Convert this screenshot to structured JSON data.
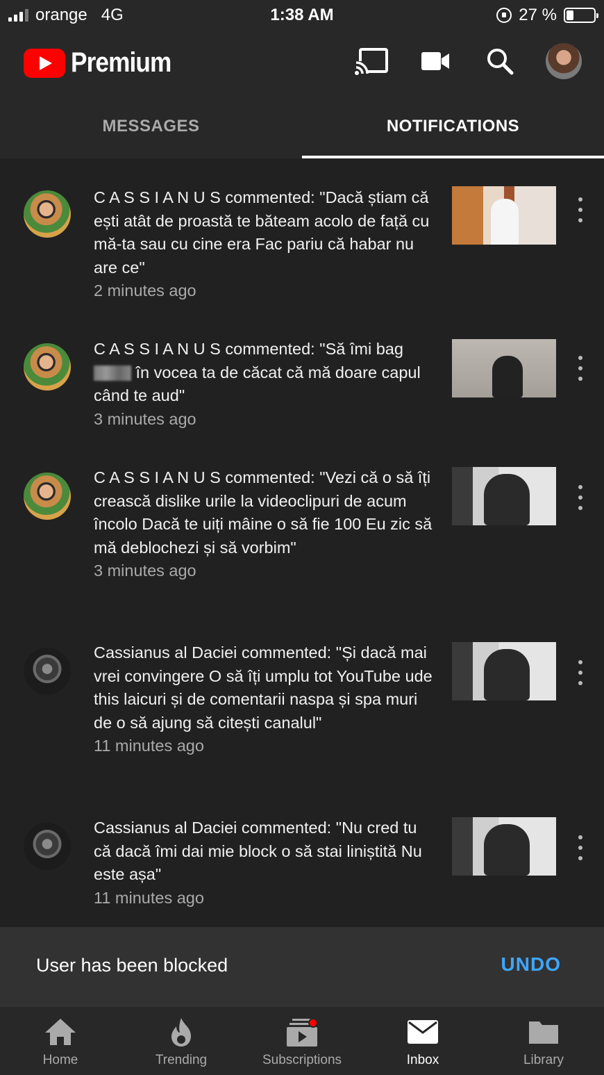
{
  "status_bar": {
    "carrier": "orange",
    "network": "4G",
    "time": "1:38 AM",
    "battery_percent_label": "27 %",
    "battery_level": 0.27
  },
  "app_bar": {
    "logo_text": "Premium",
    "icons": [
      "cast-icon",
      "video-camera-icon",
      "search-icon",
      "avatar"
    ]
  },
  "tabs": [
    {
      "label": "MESSAGES",
      "active": false
    },
    {
      "label": "NOTIFICATIONS",
      "active": true
    }
  ],
  "notifications": [
    {
      "author": "C A S S I A N U S",
      "text": "C A S S I A N U S commented: \"Dacă știam că ești atât de proastă te băteam acolo de față cu mă-ta sau cu cine era Fac pariu că habar nu are ce\"",
      "time": "2 minutes ago"
    },
    {
      "author": "C A S S I A N U S",
      "text_before": "C A S S I A N U S commented: \"Să îmi bag",
      "text_after": "în vocea ta de căcat că mă doare capul când te aud\"",
      "time": "3 minutes ago"
    },
    {
      "author": "C A S S I A N U S",
      "text": "C A S S I A N U S commented: \"Vezi că o să îți crească dislike urile la videoclipuri de acum încolo Dacă te uiți mâine o să fie 100 Eu zic să mă deblochezi și să vorbim\"",
      "time": "3 minutes ago"
    },
    {
      "author": "Cassianus al Daciei",
      "text": "Cassianus al Daciei commented: \"Și dacă mai vrei convingere O să îți umplu tot YouTube ude this laicuri și de comentarii naspa și spa muri de o să ajung să citești canalul\"",
      "time": "11 minutes ago"
    },
    {
      "author": "Cassianus al Daciei",
      "text": "Cassianus al Daciei commented: \"Nu cred tu că dacă îmi dai mie block o să stai liniștită Nu este așa\"",
      "time": "11 minutes ago"
    }
  ],
  "snackbar": {
    "message": "User has been blocked",
    "action": "UNDO",
    "action_color": "#3ea6ff"
  },
  "bottom_nav": [
    {
      "label": "Home",
      "icon": "home-icon",
      "active": false
    },
    {
      "label": "Trending",
      "icon": "flame-icon",
      "active": false
    },
    {
      "label": "Subscriptions",
      "icon": "subscriptions-icon",
      "active": false
    },
    {
      "label": "Inbox",
      "icon": "mail-icon",
      "active": true
    },
    {
      "label": "Library",
      "icon": "folder-icon",
      "active": false
    }
  ],
  "colors": {
    "background": "#282828",
    "list_background": "#212121",
    "brand_red": "#ff0000",
    "secondary_text": "#aaaaaa"
  }
}
